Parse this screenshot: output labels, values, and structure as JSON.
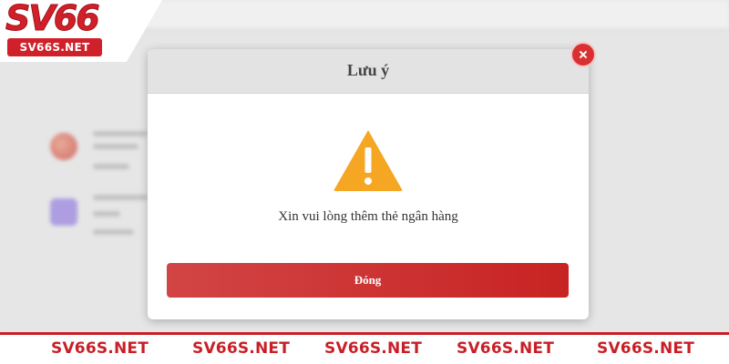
{
  "logo": {
    "main": "SV66",
    "sub": "SV66S.NET"
  },
  "background": {
    "nav_items": [
      "",
      "",
      "",
      "",
      "",
      "",
      ""
    ],
    "breadcrumb": ""
  },
  "modal": {
    "title": "Lưu ý",
    "icon": "warning-triangle-icon",
    "message": "Xin vui lòng thêm thẻ ngân hàng",
    "button_label": "Đóng",
    "close_icon": "close-icon"
  },
  "bottom_strip": {
    "items": [
      "SV66S.NET",
      "SV66S.NET",
      "SV66S.NET",
      "SV66S.NET",
      "SV66S.NET"
    ]
  },
  "colors": {
    "brand_red": "#d0202a",
    "warning_orange": "#f5a623",
    "button_red": "#c82323"
  }
}
